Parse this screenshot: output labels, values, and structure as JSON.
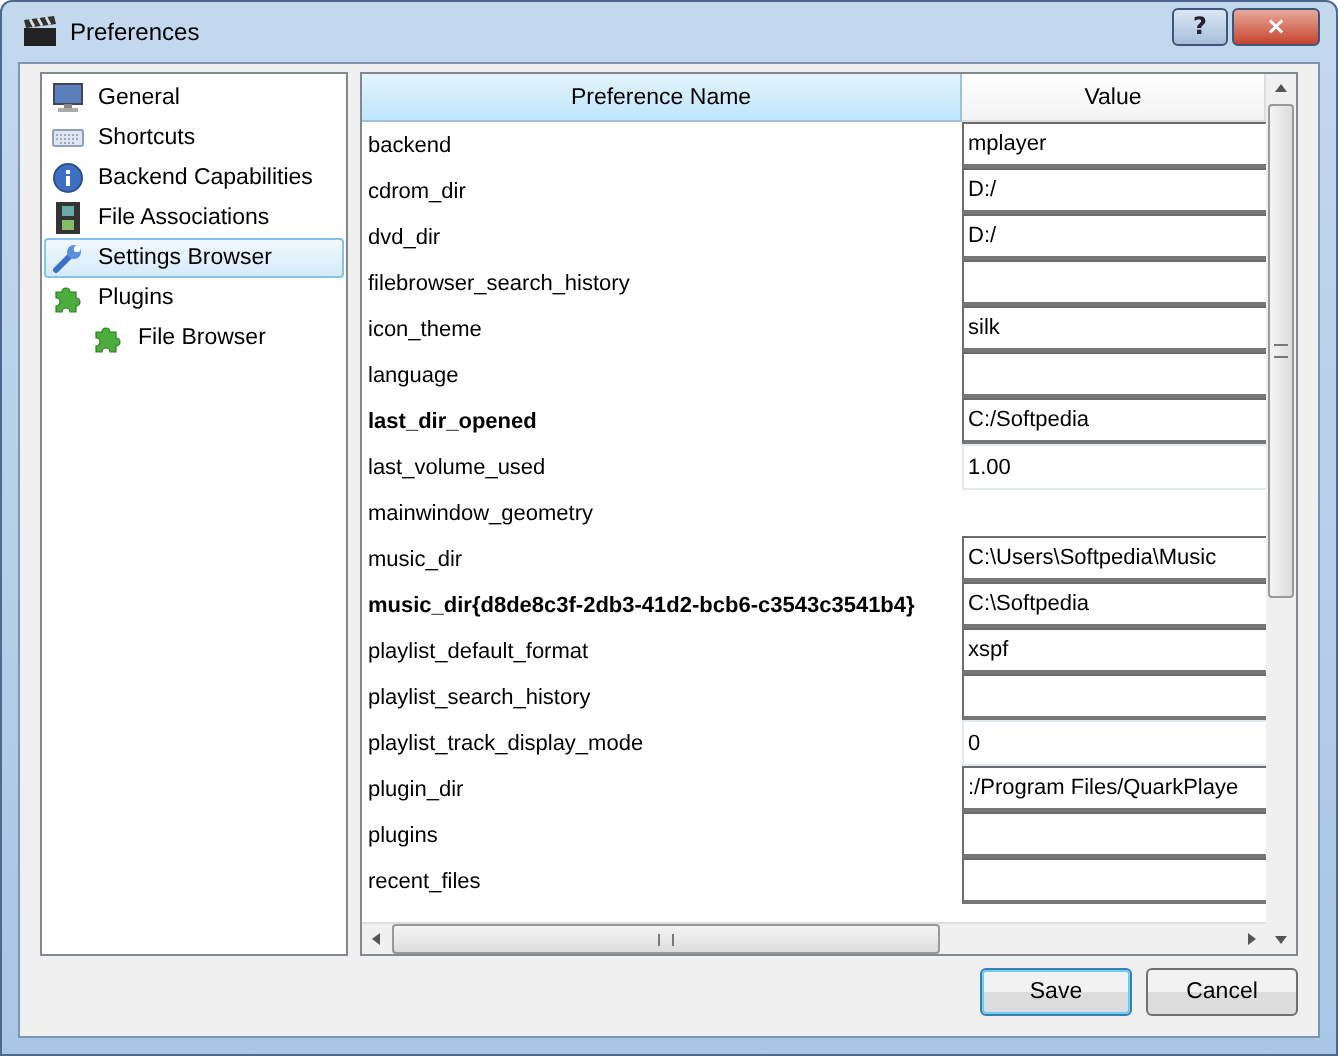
{
  "window": {
    "title": "Preferences",
    "buttons": [
      "?",
      "×"
    ]
  },
  "sidebar": {
    "items": [
      {
        "label": "General",
        "selected": false
      },
      {
        "label": "Shortcuts",
        "selected": false
      },
      {
        "label": "Backend Capabilities",
        "selected": false
      },
      {
        "label": "File Associations",
        "selected": false
      },
      {
        "label": "Settings Browser",
        "selected": true
      },
      {
        "label": "Plugins",
        "selected": false,
        "children": [
          {
            "label": "File Browser",
            "selected": false
          }
        ]
      }
    ]
  },
  "table": {
    "columns": [
      "Preference Name",
      "Value"
    ],
    "rows": [
      {
        "name": "backend",
        "bold": false,
        "kind": "field",
        "value": "mplayer"
      },
      {
        "name": "cdrom_dir",
        "bold": false,
        "kind": "field",
        "value": "D:/"
      },
      {
        "name": "dvd_dir",
        "bold": false,
        "kind": "field",
        "value": "D:/"
      },
      {
        "name": "filebrowser_search_history",
        "bold": false,
        "kind": "field"
      },
      {
        "name": "icon_theme",
        "bold": false,
        "kind": "field",
        "value": "silk"
      },
      {
        "name": "language",
        "bold": false,
        "kind": "field"
      },
      {
        "name": "last_dir_opened",
        "bold": true,
        "kind": "field",
        "value": "C:/Softpedia"
      },
      {
        "name": "last_volume_used",
        "bold": false,
        "kind": "spin",
        "value": "1.00"
      },
      {
        "name": "mainwindow_geometry",
        "bold": false,
        "kind": "none"
      },
      {
        "name": "music_dir",
        "bold": false,
        "kind": "field",
        "value": "C:\\Users\\Softpedia\\Music"
      },
      {
        "name": "music_dir{d8de8c3f-2db3-41d2-bcb6-c3543c3541b4}",
        "bold": true,
        "kind": "field",
        "value": "C:\\Softpedia"
      },
      {
        "name": "playlist_default_format",
        "bold": false,
        "kind": "field",
        "value": "xspf"
      },
      {
        "name": "playlist_search_history",
        "bold": false,
        "kind": "field"
      },
      {
        "name": "playlist_track_display_mode",
        "bold": false,
        "kind": "spin",
        "value": "0"
      },
      {
        "name": "plugin_dir",
        "bold": false,
        "kind": "field",
        "value": ":/Program Files/QuarkPlaye"
      },
      {
        "name": "plugins",
        "bold": false,
        "kind": "field"
      },
      {
        "name": "recent_files",
        "bold": false,
        "kind": "field"
      }
    ]
  },
  "buttons": [
    {
      "label": "Save",
      "default": true
    },
    {
      "label": "Cancel",
      "default": false
    }
  ]
}
